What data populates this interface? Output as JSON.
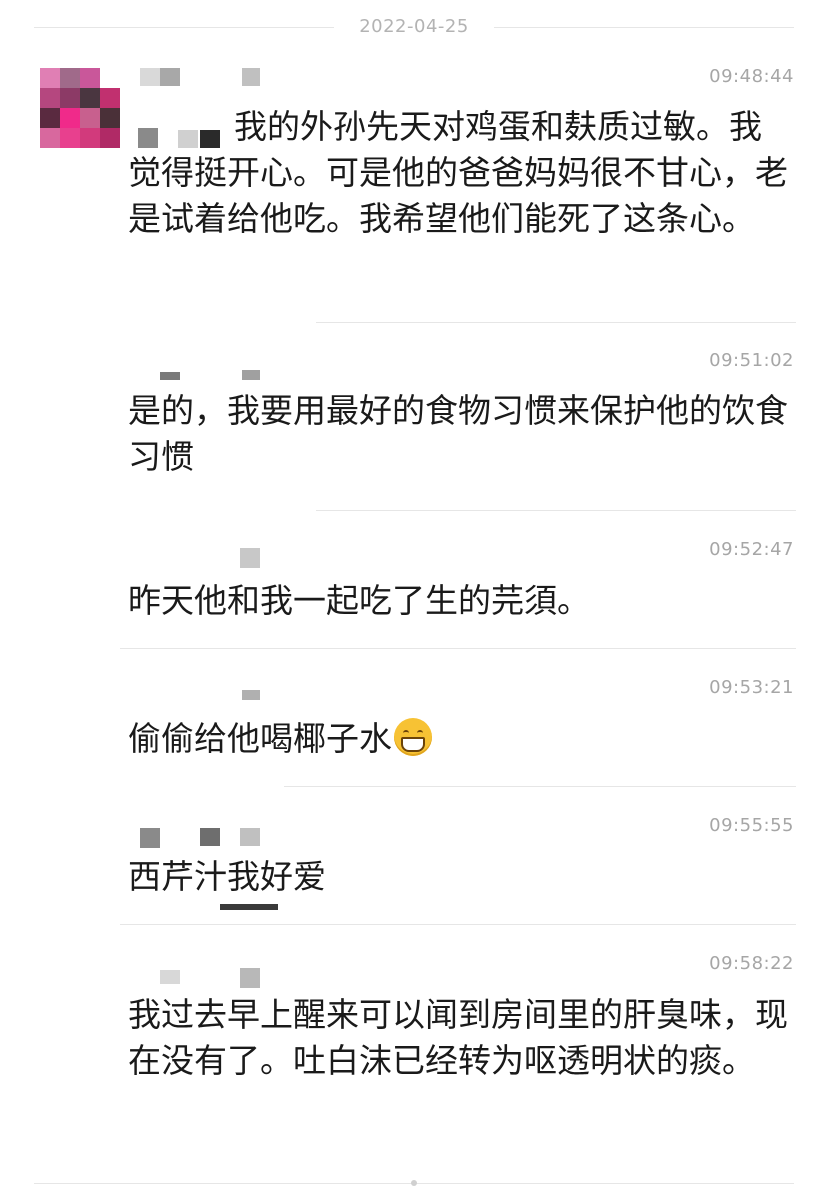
{
  "date_divider": "2022-04-25",
  "messages": [
    {
      "time": "09:48:44",
      "text": "我的外孙先天对鸡蛋和麸质过敏。我觉得挺开心。可是他的爸爸妈妈很不甘心，老是试着给他吃。我希望他们能死了这条心。"
    },
    {
      "time": "09:51:02",
      "text": "是的，我要用最好的食物习惯来保护他的饮食习惯"
    },
    {
      "time": "09:52:47",
      "text": "昨天他和我一起吃了生的芫須。"
    },
    {
      "time": "09:53:21",
      "text": "偷偷给他喝椰子水",
      "emoji": "grinning-face"
    },
    {
      "time": "09:55:55",
      "text": "西芹汁我好爱"
    },
    {
      "time": "09:58:22",
      "text": "我过去早上醒来可以闻到房间里的肝臭味，现在没有了。吐白沫已经转为呕透明状的痰。"
    }
  ],
  "colors": {
    "text": "#1a1a1a",
    "timestamp": "#a6a6a6",
    "divider": "#e6e6e6"
  }
}
